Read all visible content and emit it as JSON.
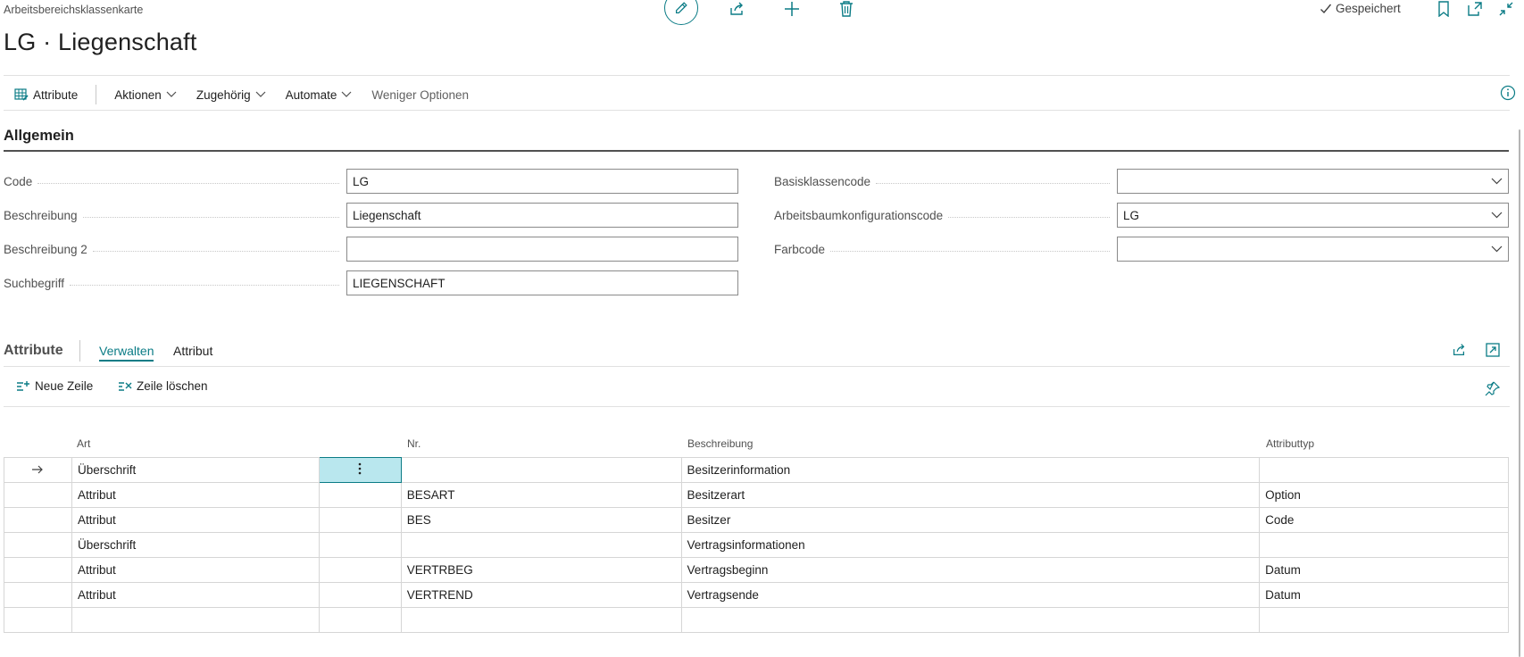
{
  "header": {
    "breadcrumb": "Arbeitsbereichsklassenkarte",
    "title": "LG · Liegenschaft",
    "saved_label": "Gespeichert"
  },
  "actions": {
    "attribute": "Attribute",
    "aktionen": "Aktionen",
    "zugehoerig": "Zugehörig",
    "automate": "Automate",
    "less": "Weniger Optionen"
  },
  "general": {
    "title": "Allgemein",
    "left": [
      {
        "label": "Code",
        "value": "LG"
      },
      {
        "label": "Beschreibung",
        "value": "Liegenschaft"
      },
      {
        "label": "Beschreibung 2",
        "value": ""
      },
      {
        "label": "Suchbegriff",
        "value": "LIEGENSCHAFT"
      }
    ],
    "right": [
      {
        "label": "Basisklassencode",
        "value": ""
      },
      {
        "label": "Arbeitsbaumkonfigurationscode",
        "value": "LG"
      },
      {
        "label": "Farbcode",
        "value": ""
      }
    ]
  },
  "lines": {
    "title": "Attribute",
    "tabs": [
      "Verwalten",
      "Attribut"
    ],
    "new_line": "Neue Zeile",
    "delete_line": "Zeile löschen",
    "columns": [
      "Art",
      "Nr.",
      "Beschreibung",
      "Attributtyp"
    ],
    "rows": [
      {
        "art": "Überschrift",
        "nr": "",
        "beschreibung": "Besitzerinformation",
        "typ": ""
      },
      {
        "art": "Attribut",
        "nr": "BESART",
        "beschreibung": "Besitzerart",
        "typ": "Option"
      },
      {
        "art": "Attribut",
        "nr": "BES",
        "beschreibung": "Besitzer",
        "typ": "Code"
      },
      {
        "art": "Überschrift",
        "nr": "",
        "beschreibung": "Vertragsinformationen",
        "typ": ""
      },
      {
        "art": "Attribut",
        "nr": "VERTRBEG",
        "beschreibung": "Vertragsbeginn",
        "typ": "Datum"
      },
      {
        "art": "Attribut",
        "nr": "VERTREND",
        "beschreibung": "Vertragsende",
        "typ": "Datum"
      }
    ]
  },
  "colors": {
    "accent": "#0b7c86",
    "selected_cell": "#b9e7ee"
  }
}
